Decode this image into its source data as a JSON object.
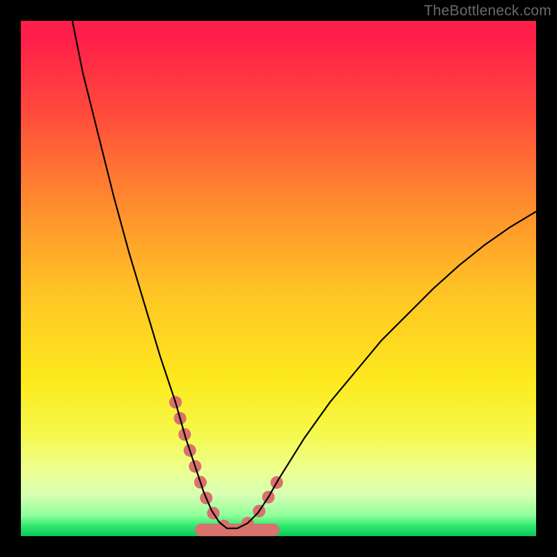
{
  "watermark": "TheBottleneck.com",
  "chart_data": {
    "type": "line",
    "title": "",
    "xlabel": "",
    "ylabel": "",
    "xlim": [
      0,
      100
    ],
    "ylim": [
      0,
      100
    ],
    "grid": false,
    "series": [
      {
        "name": "curve",
        "color": "#000000",
        "x": [
          10,
          12,
          15,
          18,
          21,
          24,
          27,
          30,
          32,
          34,
          35.5,
          37,
          38.5,
          40,
          42,
          44,
          46,
          48,
          50,
          55,
          60,
          65,
          70,
          75,
          80,
          85,
          90,
          95,
          100
        ],
        "y": [
          100,
          90,
          78,
          66,
          55,
          45,
          35,
          26,
          19,
          13,
          8.5,
          5,
          2.7,
          1.5,
          1.5,
          2.5,
          4.5,
          7.5,
          11,
          19,
          26,
          32,
          38,
          43,
          48,
          52.5,
          56.5,
          60,
          63
        ]
      }
    ],
    "highlighted_segments": [
      {
        "name": "left-marker-band",
        "color": "#d9716d",
        "x": [
          30,
          32,
          34,
          35.5,
          37,
          38.5,
          40
        ],
        "y": [
          26,
          19,
          13,
          8.5,
          5,
          2.7,
          1.5
        ]
      },
      {
        "name": "right-marker-band",
        "color": "#d9716d",
        "x": [
          44,
          46,
          48,
          50
        ],
        "y": [
          2.5,
          4.5,
          7.5,
          11
        ]
      }
    ],
    "bottom_band": {
      "name": "plateau",
      "color": "#d9716d",
      "x_start": 35,
      "x_end": 49,
      "y": 1.2
    }
  }
}
